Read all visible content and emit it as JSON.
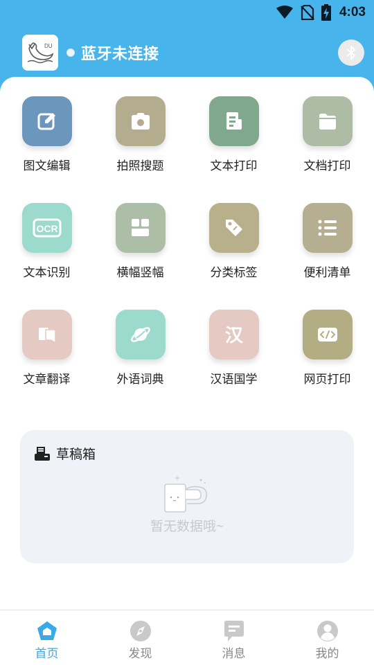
{
  "status_bar": {
    "time": "4:03",
    "icons": [
      "wifi-icon",
      "no-sim-icon",
      "battery-charging-icon"
    ]
  },
  "header": {
    "bluetooth_status": "蓝牙未连接",
    "logo_text": "DU",
    "logo_icon": "whale-logo-icon",
    "bluetooth_icon": "bluetooth-icon"
  },
  "tools": [
    {
      "label": "图文编辑",
      "icon": "edit-icon",
      "color": "#6c97bd"
    },
    {
      "label": "拍照搜题",
      "icon": "camera-icon",
      "color": "#b3ad8d"
    },
    {
      "label": "文本打印",
      "icon": "document-print-icon",
      "color": "#7fa88c"
    },
    {
      "label": "文档打印",
      "icon": "folder-icon",
      "color": "#aebca5"
    },
    {
      "label": "文本识别",
      "icon": "ocr-icon",
      "icon_text": "OCR",
      "color": "#9cdacd"
    },
    {
      "label": "横幅竖幅",
      "icon": "layout-icon",
      "color": "#adbea6"
    },
    {
      "label": "分类标签",
      "icon": "tag-icon",
      "color": "#b7b08b"
    },
    {
      "label": "便利清单",
      "icon": "list-icon",
      "color": "#b5ae91"
    },
    {
      "label": "文章翻译",
      "icon": "translate-icon",
      "color": "#e4cac2"
    },
    {
      "label": "外语词典",
      "icon": "planet-icon",
      "color": "#9cdacd"
    },
    {
      "label": "汉语国学",
      "icon": "han-icon",
      "icon_text": "汉",
      "color": "#e4cac2"
    },
    {
      "label": "网页打印",
      "icon": "code-icon",
      "color": "#b3ad83"
    }
  ],
  "drafts": {
    "title": "草稿箱",
    "icon": "printer-icon",
    "empty_text": "暂无数据哦~",
    "empty_icon": "empty-cup-icon"
  },
  "nav": [
    {
      "label": "首页",
      "icon": "home-icon",
      "active": true
    },
    {
      "label": "发现",
      "icon": "discover-icon",
      "active": false
    },
    {
      "label": "消息",
      "icon": "message-icon",
      "active": false
    },
    {
      "label": "我的",
      "icon": "profile-icon",
      "active": false
    }
  ]
}
